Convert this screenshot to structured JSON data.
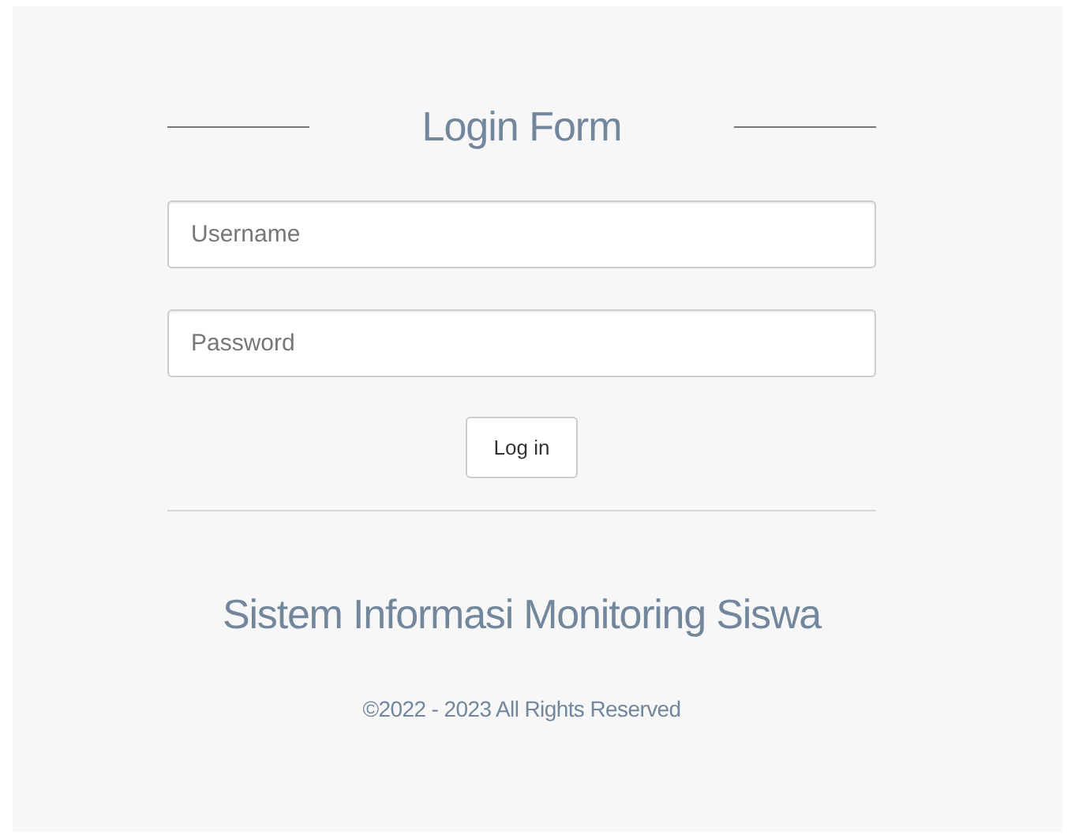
{
  "title": "Login Form",
  "fields": [
    {
      "placeholder": "Username"
    },
    {
      "placeholder": "Password"
    }
  ],
  "button": "Log in",
  "app_name": "Sistem Informasi Monitoring Siswa",
  "copyright": "©2022 - 2023 All Rights Reserved"
}
